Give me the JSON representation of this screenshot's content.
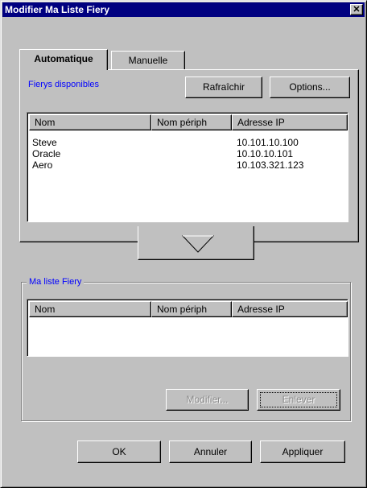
{
  "window": {
    "title": "Modifier Ma Liste Fiery",
    "close_glyph": "✕"
  },
  "tabs": [
    {
      "label": "Automatique",
      "active": true
    },
    {
      "label": "Manuelle",
      "active": false
    }
  ],
  "available": {
    "label": "Fierys disponibles",
    "refresh_label": "Rafraîchir",
    "options_label": "Options...",
    "columns": [
      "Nom",
      "Nom périph",
      "Adresse IP"
    ],
    "rows": [
      {
        "name": "Steve",
        "device": "",
        "ip": "10.101.10.100"
      },
      {
        "name": "Oracle",
        "device": "",
        "ip": "10.10.10.101"
      },
      {
        "name": "Aero",
        "device": "",
        "ip": "10.103.321.123"
      }
    ]
  },
  "add_arrow_icon": "down-triangle-icon",
  "my_list": {
    "label": "Ma liste Fiery",
    "columns": [
      "Nom",
      "Nom périph",
      "Adresse IP"
    ],
    "modify_label": "Modifier...",
    "remove_label": "Enlever"
  },
  "footer": {
    "ok_label": "OK",
    "cancel_label": "Annuler",
    "apply_label": "Appliquer"
  },
  "colors": {
    "face": "#c0c0c0",
    "title_bar": "#000080",
    "accent_label": "#0000ff"
  }
}
